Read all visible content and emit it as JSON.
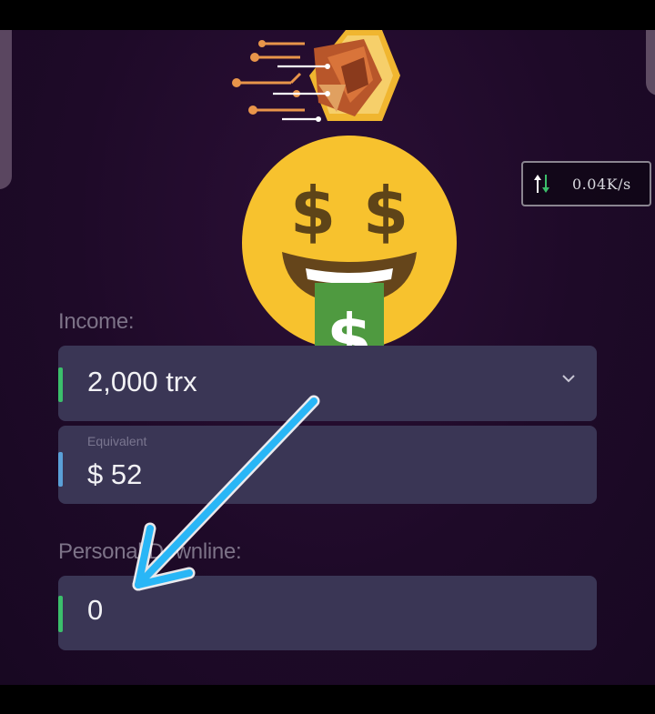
{
  "speed": {
    "value": "0.04K/s"
  },
  "income": {
    "label": "Income:",
    "value": "2,000 trx"
  },
  "equivalent": {
    "label": "Equivalent",
    "value": "$ 52"
  },
  "downline": {
    "label": "Personal Downline:",
    "value": "0"
  },
  "colors": {
    "accent_green": "#3bbf6b",
    "accent_blue": "#5aa0d8",
    "annotation_arrow": "#29b6f6",
    "field_bg": "#3a3655"
  },
  "icons": [
    "logo-hex-lion",
    "money-mouth-emoji",
    "network-speed-icon",
    "chevron-down-icon",
    "annotation-arrow"
  ]
}
